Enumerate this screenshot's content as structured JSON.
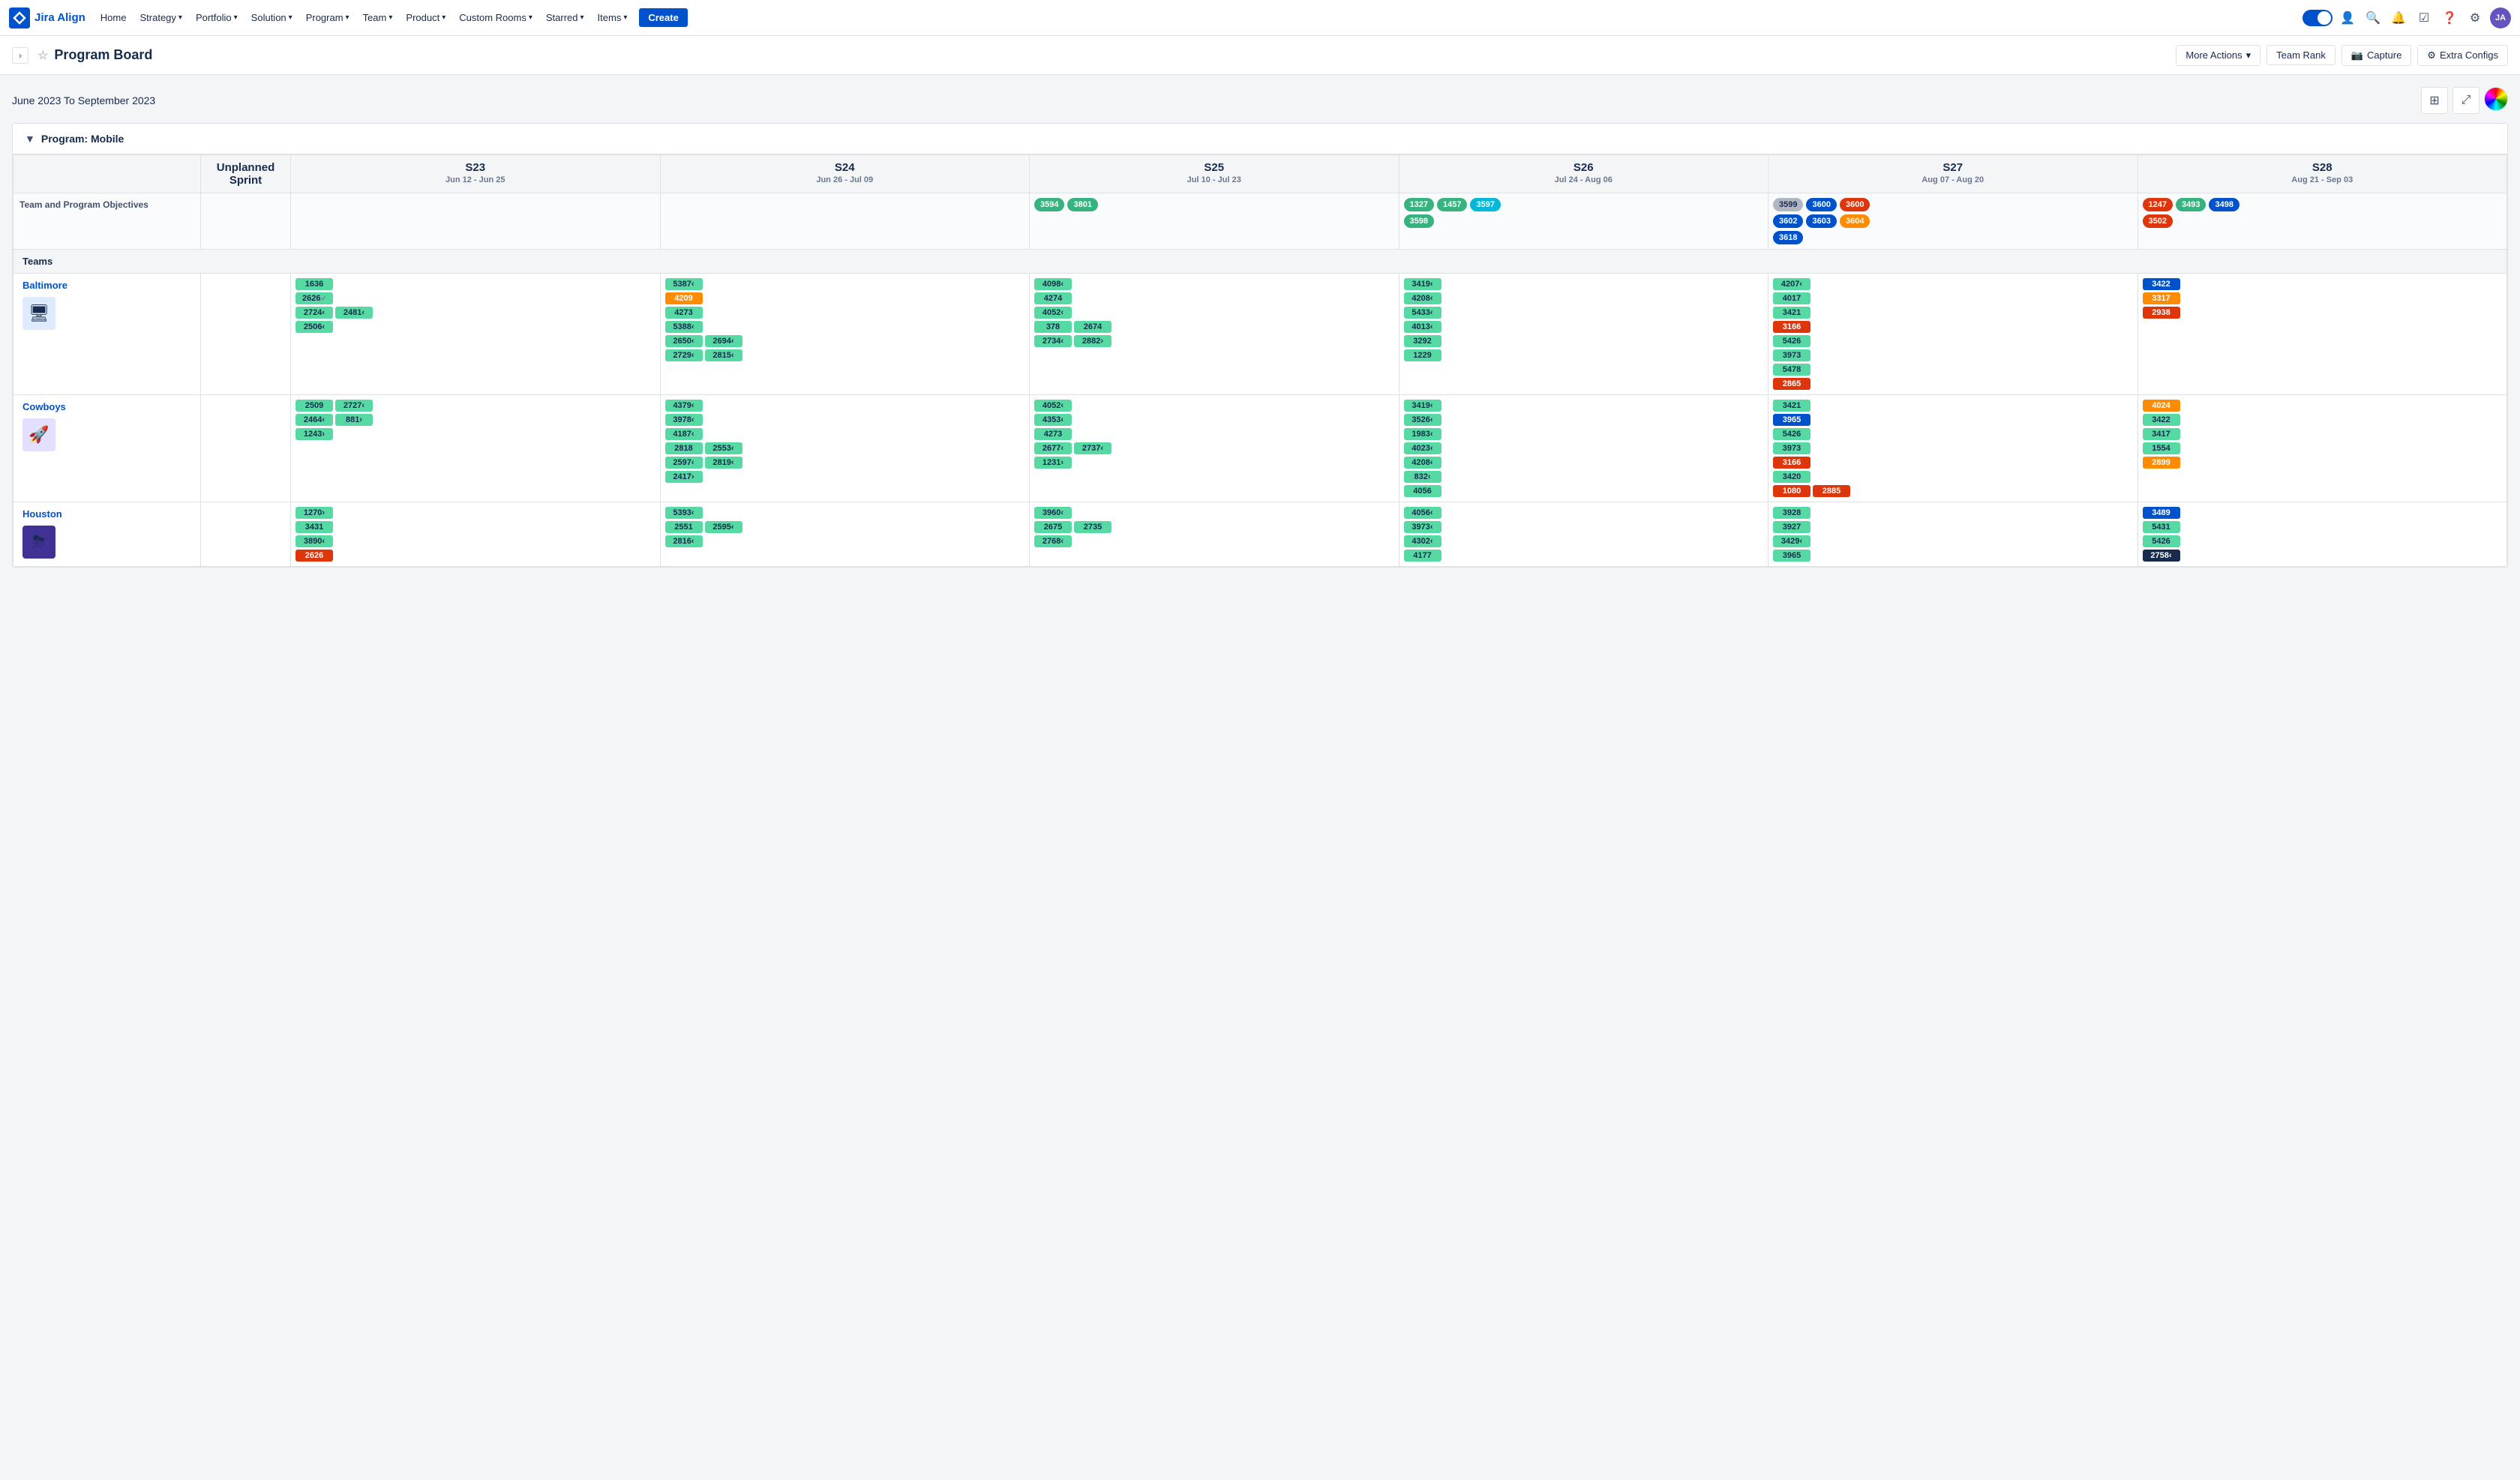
{
  "app": {
    "logo_text": "Jira Align",
    "nav_items": [
      {
        "label": "Home",
        "has_dropdown": false
      },
      {
        "label": "Strategy",
        "has_dropdown": true
      },
      {
        "label": "Portfolio",
        "has_dropdown": true
      },
      {
        "label": "Solution",
        "has_dropdown": true
      },
      {
        "label": "Program",
        "has_dropdown": true
      },
      {
        "label": "Team",
        "has_dropdown": true
      },
      {
        "label": "Product",
        "has_dropdown": true
      },
      {
        "label": "Custom Rooms",
        "has_dropdown": true
      },
      {
        "label": "Starred",
        "has_dropdown": true
      },
      {
        "label": "Items",
        "has_dropdown": true
      }
    ],
    "create_label": "Create"
  },
  "page": {
    "title": "Program Board",
    "actions": [
      {
        "label": "More Actions",
        "has_dropdown": true
      },
      {
        "label": "Team Rank",
        "has_dropdown": false
      },
      {
        "label": "Capture",
        "has_icon": true
      },
      {
        "label": "Extra Configs",
        "has_icon": true
      }
    ]
  },
  "board": {
    "date_range": "June 2023 To September 2023",
    "program_label": "Program: Mobile",
    "sprints": [
      {
        "name": "S23",
        "dates": "Jun 12 - Jun 25"
      },
      {
        "name": "S24",
        "dates": "Jun 26 - Jul 09"
      },
      {
        "name": "S25",
        "dates": "Jul 10 - Jul 23"
      },
      {
        "name": "S26",
        "dates": "Jul 24 - Aug 06"
      },
      {
        "name": "S27",
        "dates": "Aug 07 - Aug 20"
      },
      {
        "name": "S28",
        "dates": "Aug 21 - Sep 03"
      }
    ],
    "row_labels": {
      "unplanned": "Unplanned Sprint",
      "objectives": "Team and Program Objectives",
      "teams": "Teams"
    },
    "objectives": {
      "s23": [],
      "s24": [],
      "s25": [
        {
          "id": "3594",
          "color": "green"
        },
        {
          "id": "3801",
          "color": "green"
        }
      ],
      "s26": [
        {
          "id": "1327",
          "color": "green"
        },
        {
          "id": "1457",
          "color": "green"
        },
        {
          "id": "3597",
          "color": "teal"
        },
        {
          "id": "3598",
          "color": "green"
        }
      ],
      "s27": [
        {
          "id": "3599",
          "color": "blue"
        },
        {
          "id": "3600",
          "color": "red"
        },
        {
          "id": "3602",
          "color": "blue"
        },
        {
          "id": "3603",
          "color": "blue"
        },
        {
          "id": "3604",
          "color": "orange"
        },
        {
          "id": "3618",
          "color": "blue"
        }
      ],
      "s28": [
        {
          "id": "1247",
          "color": "red"
        },
        {
          "id": "3493",
          "color": "green"
        },
        {
          "id": "3498",
          "color": "blue"
        },
        {
          "id": "3502",
          "color": "red"
        }
      ]
    },
    "teams": [
      {
        "name": "Baltimore",
        "avatar_icon": "🖥",
        "avatar_color": "blue",
        "sprints": {
          "s23": [
            [
              "1636"
            ],
            [
              "2626"
            ],
            [
              "2724<",
              "2481<"
            ],
            [
              "2506<"
            ]
          ],
          "s24": [
            [
              "5387<"
            ],
            [
              "4209"
            ],
            [
              "4273"
            ],
            [
              "5388<"
            ],
            [
              "2650<",
              "2694<"
            ],
            [
              "2729<",
              "2815<"
            ]
          ],
          "s25": [
            [
              "4098<"
            ],
            [
              "4274"
            ],
            [
              "4052<"
            ],
            [
              "378",
              "2674"
            ],
            [
              "2734<",
              "2882>"
            ]
          ],
          "s26": [
            [
              "3419<"
            ],
            [
              "4208<"
            ],
            [
              "5433<"
            ],
            [
              "4013<"
            ],
            [
              "3292"
            ],
            [
              "1229"
            ]
          ],
          "s27": [
            [
              "4207<"
            ],
            [
              "4017"
            ],
            [
              "3421"
            ],
            [
              "3166"
            ],
            [
              "5426"
            ],
            [
              "3973"
            ],
            [
              "5478"
            ],
            [
              "2865"
            ]
          ],
          "s28": [
            [
              "3422"
            ],
            [
              "3317"
            ],
            [
              "2938"
            ]
          ]
        }
      },
      {
        "name": "Cowboys",
        "avatar_icon": "🚀",
        "avatar_color": "purple",
        "sprints": {
          "s23": [
            [
              "2509",
              "2727<"
            ],
            [
              "2464<",
              "881>"
            ],
            [
              "1243>"
            ]
          ],
          "s24": [
            [
              "4379<"
            ],
            [
              "3978<"
            ],
            [
              "4187<"
            ],
            [
              "2818",
              "2553<"
            ],
            [
              "2597<",
              "2819<"
            ],
            [
              "2417>"
            ]
          ],
          "s25": [
            [
              "4052<"
            ],
            [
              "4353<"
            ],
            [
              "4273"
            ],
            [
              "2677<",
              "2737<"
            ],
            [
              "1231>"
            ]
          ],
          "s26": [
            [
              "3419<"
            ],
            [
              "3526<"
            ],
            [
              "1983<"
            ],
            [
              "4023<"
            ],
            [
              "4208<"
            ],
            [
              "832<"
            ],
            [
              "4056"
            ]
          ],
          "s27": [
            [
              "3421"
            ],
            [
              "3965"
            ],
            [
              "5426"
            ],
            [
              "3973"
            ],
            [
              "3166"
            ],
            [
              "3420"
            ],
            [
              "1080",
              "2885"
            ]
          ],
          "s28": [
            [
              "4024"
            ],
            [
              "3422"
            ],
            [
              "3417"
            ],
            [
              "1554"
            ],
            [
              "2899"
            ]
          ]
        }
      },
      {
        "name": "Houston",
        "avatar_icon": "⛈",
        "avatar_color": "dark-purple",
        "sprints": {
          "s23": [
            [
              "1270>"
            ],
            [
              "3431"
            ],
            [
              "3890<"
            ],
            [
              "2626"
            ]
          ],
          "s24": [
            [
              "5393<"
            ],
            [
              "2551",
              "2595<"
            ],
            [
              "2816<"
            ]
          ],
          "s25": [
            [
              "3960<"
            ],
            [
              "2675",
              "2735"
            ],
            [
              "2768<"
            ]
          ],
          "s26": [
            [
              "4056<"
            ],
            [
              "3973<"
            ],
            [
              "4302<"
            ],
            [
              "4177"
            ]
          ],
          "s27": [
            [
              "3928"
            ],
            [
              "3927"
            ],
            [
              "3429<"
            ],
            [
              "3965"
            ]
          ],
          "s28": [
            [
              "3489"
            ],
            [
              "5431"
            ],
            [
              "5426"
            ],
            [
              "2758<"
            ]
          ]
        }
      }
    ]
  }
}
